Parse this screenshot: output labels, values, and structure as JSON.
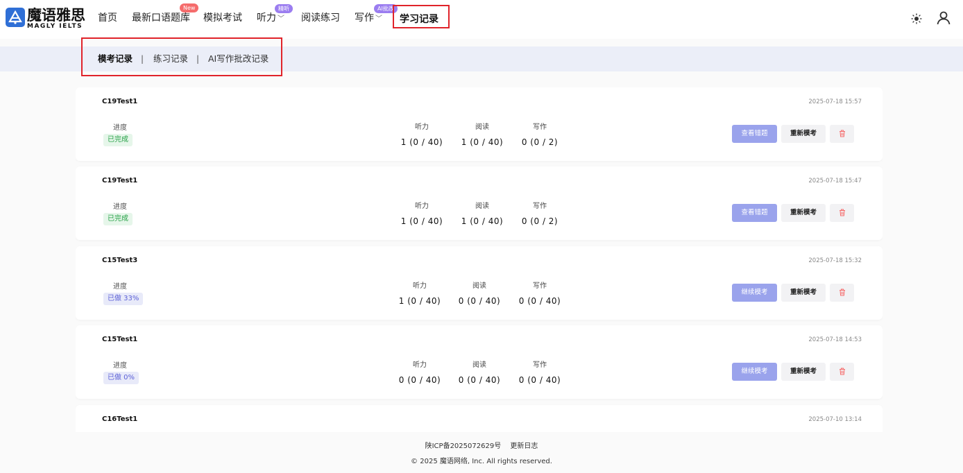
{
  "brand": {
    "name_cn": "魔语雅思",
    "name_en": "MAGLY IELTS"
  },
  "nav": {
    "home": "首页",
    "speaking": "最新口语题库",
    "speaking_badge": "New",
    "mock": "模拟考试",
    "listening": "听力",
    "listening_badge": "精听",
    "reading": "阅读练习",
    "writing": "写作",
    "writing_badge": "AI批改",
    "records": "学习记录"
  },
  "icons": {
    "theme": "sun-icon",
    "user": "user-icon",
    "delete": "trash-icon"
  },
  "subtabs": {
    "mock": "模考记录",
    "practice": "练习记录",
    "ai_writing": "AI写作批改记录",
    "separator": "|"
  },
  "labels": {
    "progress": "进度",
    "listening": "听力",
    "reading": "阅读",
    "writing": "写作",
    "view_errors": "查看错题",
    "continue": "继续模考",
    "retake": "重新模考"
  },
  "records": [
    {
      "title": "C19Test1",
      "date": "2025-07-18 15:57",
      "status": "已完成",
      "listening": "1 (0 / 40)",
      "reading": "1 (0 / 40)",
      "writing": "0 (0 / 2)",
      "primary": "查看错题"
    },
    {
      "title": "C19Test1",
      "date": "2025-07-18 15:47",
      "status": "已完成",
      "listening": "1 (0 / 40)",
      "reading": "1 (0 / 40)",
      "writing": "0 (0 / 2)",
      "primary": "查看错题"
    },
    {
      "title": "C15Test3",
      "date": "2025-07-18 15:32",
      "status": "已做 33%",
      "listening": "1 (0 / 40)",
      "reading": "0 (0 / 40)",
      "writing": "0 (0 / 40)",
      "primary": "继续模考"
    },
    {
      "title": "C15Test1",
      "date": "2025-07-18 14:53",
      "status": "已做 0%",
      "listening": "0 (0 / 40)",
      "reading": "0 (0 / 40)",
      "writing": "0 (0 / 40)",
      "primary": "继续模考"
    },
    {
      "title": "C16Test1",
      "date": "2025-07-10 13:14"
    }
  ],
  "colors": {
    "accent": "#9aa3ec",
    "highlight_box": "#e0232a",
    "done": "#27a147",
    "partial": "#5a5fd6"
  },
  "footer": {
    "icp": "陕ICP备2025072629号",
    "changelog": "更新日志",
    "copyright": "© 2025 魔语网络, Inc. All rights reserved."
  }
}
